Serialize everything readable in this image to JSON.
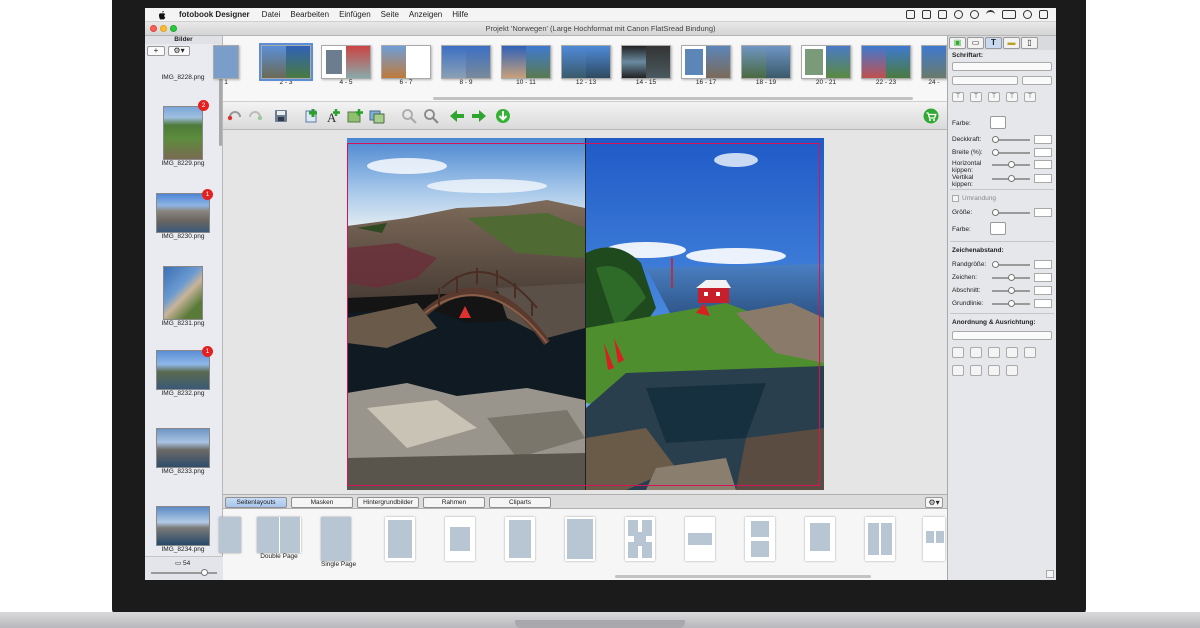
{
  "menubar": {
    "app_name": "fotobook Designer",
    "items": [
      "Datei",
      "Bearbeiten",
      "Einfügen",
      "Seite",
      "Anzeigen",
      "Hilfe"
    ]
  },
  "window": {
    "title": "Projekt 'Norwegen' (Large Hochformat mit Canon FlatSread Bindung)"
  },
  "sidebar": {
    "title": "Bilder",
    "add_label": "+",
    "gear_label": "⚙▾",
    "images": [
      {
        "name": "IMG_8228.png",
        "badge": ""
      },
      {
        "name": "IMG_8229.png",
        "badge": "2"
      },
      {
        "name": "IMG_8230.png",
        "badge": "1"
      },
      {
        "name": "IMG_8231.png",
        "badge": ""
      },
      {
        "name": "IMG_8232.png",
        "badge": "1"
      },
      {
        "name": "IMG_8233.png",
        "badge": ""
      },
      {
        "name": "IMG_8234.png",
        "badge": ""
      }
    ],
    "count": "54"
  },
  "pages": [
    "1",
    "2 - 3",
    "4 - 5",
    "6 - 7",
    "8 - 9",
    "10 - 11",
    "12 - 13",
    "14 - 15",
    "16 - 17",
    "18 - 19",
    "20 - 21",
    "22 - 23",
    "24 -"
  ],
  "bottom_tabs": [
    "Seitenlayouts",
    "Masken",
    "Hintergrundbilder",
    "Rahmen",
    "Cliparts"
  ],
  "layouts": [
    {
      "label": ""
    },
    {
      "label": "Double Page"
    },
    {
      "label": "Single Page"
    },
    {
      "label": ""
    },
    {
      "label": ""
    },
    {
      "label": ""
    },
    {
      "label": ""
    },
    {
      "label": ""
    },
    {
      "label": ""
    },
    {
      "label": ""
    },
    {
      "label": ""
    },
    {
      "label": ""
    }
  ],
  "inspector": {
    "schriftart": "Schriftart:",
    "farbe": "Farbe:",
    "deckkraft": "Deckkraft:",
    "breite": "Breite (%):",
    "horizontal": "Horizontal kippen:",
    "vertikal": "Vertikal kippen:",
    "umrandung": "Umrandung",
    "groesse": "Größe:",
    "farbe2": "Farbe:",
    "zeichenabstand": "Zeichenabstand:",
    "randgroesse": "Randgröße:",
    "zeichen": "Zeichen:",
    "abschnitt": "Abschnitt:",
    "grundlinie": "Grundlinie:",
    "anordnung": "Anordnung & Ausrichtung:"
  },
  "colors": {
    "badge": "#e52020",
    "trim": "#d4145a",
    "tab_active": "#a9c6ec",
    "accent_green": "#3cae3c"
  }
}
